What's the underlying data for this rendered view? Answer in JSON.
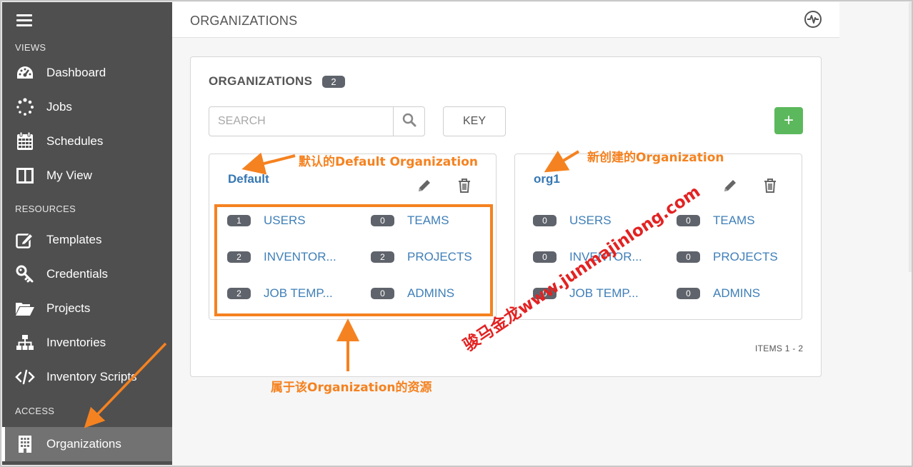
{
  "sidebar": {
    "sections": {
      "views": "VIEWS",
      "resources": "RESOURCES",
      "access": "ACCESS"
    },
    "items": [
      {
        "label": "Dashboard",
        "icon": "dashboard-icon"
      },
      {
        "label": "Jobs",
        "icon": "jobs-spinner-icon"
      },
      {
        "label": "Schedules",
        "icon": "calendar-icon"
      },
      {
        "label": "My View",
        "icon": "columns-icon"
      },
      {
        "label": "Templates",
        "icon": "edit-icon"
      },
      {
        "label": "Credentials",
        "icon": "key-icon"
      },
      {
        "label": "Projects",
        "icon": "folder-open-icon"
      },
      {
        "label": "Inventories",
        "icon": "sitemap-icon"
      },
      {
        "label": "Inventory Scripts",
        "icon": "code-icon"
      },
      {
        "label": "Organizations",
        "icon": "building-icon",
        "active": true
      }
    ]
  },
  "header": {
    "title": "ORGANIZATIONS",
    "activity_icon": "activity-stream-icon"
  },
  "panel": {
    "title": "ORGANIZATIONS",
    "count": "2",
    "search_placeholder": "SEARCH",
    "key_label": "KEY",
    "add_label": "+",
    "items_label": "ITEMS  1 - 2"
  },
  "organizations": [
    {
      "name": "Default",
      "resources": [
        {
          "count": "1",
          "label": "USERS"
        },
        {
          "count": "0",
          "label": "TEAMS"
        },
        {
          "count": "2",
          "label": "INVENTOR..."
        },
        {
          "count": "2",
          "label": "PROJECTS"
        },
        {
          "count": "2",
          "label": "JOB TEMP..."
        },
        {
          "count": "0",
          "label": "ADMINS"
        }
      ]
    },
    {
      "name": "org1",
      "resources": [
        {
          "count": "0",
          "label": "USERS"
        },
        {
          "count": "0",
          "label": "TEAMS"
        },
        {
          "count": "0",
          "label": "INVENTOR..."
        },
        {
          "count": "0",
          "label": "PROJECTS"
        },
        {
          "count": "0",
          "label": "JOB TEMP..."
        },
        {
          "count": "0",
          "label": "ADMINS"
        }
      ]
    }
  ],
  "annotations": {
    "default_org": "默认的Default Organization",
    "new_org": "新创建的Organization",
    "resources": "属于该Organization的资源",
    "watermark": "骏马金龙www.junmajinlong.com",
    "accent_color": "#f58220",
    "watermark_color": "#e32222"
  }
}
